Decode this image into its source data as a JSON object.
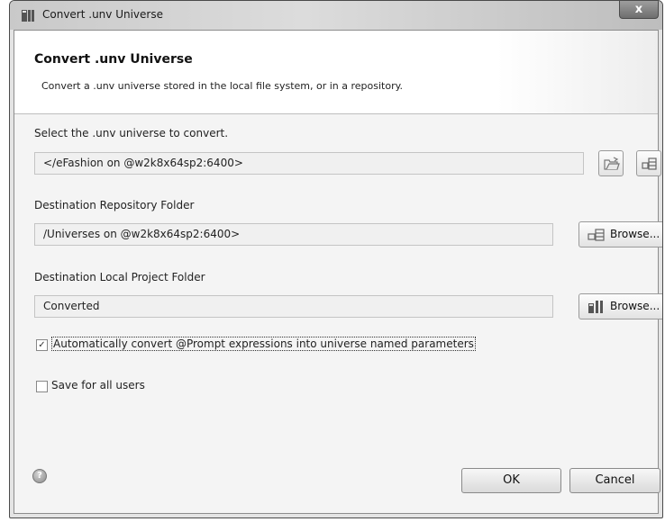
{
  "window": {
    "title": "Convert .unv Universe",
    "close_glyph": "x",
    "app_icon": "sap-designer-icon"
  },
  "header": {
    "title": "Convert .unv Universe",
    "description": "Convert a .unv universe stored in the local file system, or in a repository."
  },
  "source": {
    "label": "Select the .unv universe to convert.",
    "value": "</eFashion on  @w2k8x64sp2:6400>",
    "open_file_icon": "open-folder-icon",
    "repository_icon": "repository-icon"
  },
  "destination_repository": {
    "label": "Destination Repository Folder",
    "value": "/Universes on  @w2k8x64sp2:6400>",
    "browse_label": "Browse...",
    "browse_icon": "repository-icon"
  },
  "destination_local": {
    "label": "Destination Local Project Folder",
    "value": "Converted",
    "browse_label": "Browse...",
    "browse_icon": "project-folder-icon"
  },
  "options": {
    "convert_prompt": {
      "label": "Automatically convert @Prompt expressions into universe named parameters",
      "checked": true
    },
    "save_all_users": {
      "label": "Save for all users",
      "checked": false
    }
  },
  "footer": {
    "help_icon": "help-icon",
    "help_glyph": "?",
    "ok_label": "OK",
    "cancel_label": "Cancel"
  },
  "check_glyph": "✓"
}
